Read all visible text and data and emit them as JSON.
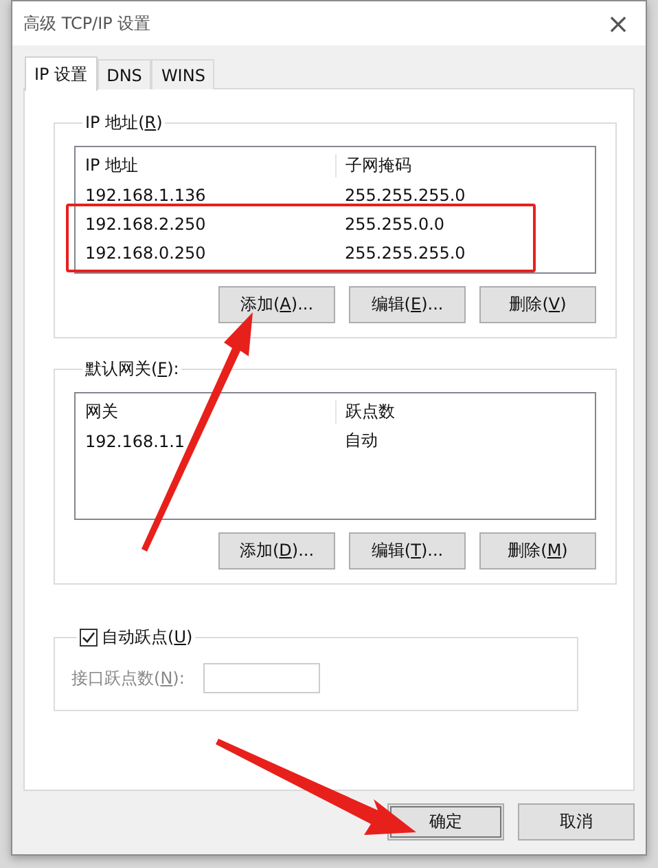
{
  "window": {
    "title": "高级 TCP/IP 设置",
    "close": "×"
  },
  "tabs": [
    {
      "label": "IP 设置",
      "selected": true
    },
    {
      "label": "DNS",
      "selected": false
    },
    {
      "label": "WINS",
      "selected": false
    }
  ],
  "ip_group": {
    "label": "IP 地址(R)",
    "columns": [
      "IP 地址",
      "子网掩码"
    ],
    "rows": [
      {
        "cells": [
          "192.168.1.136",
          "255.255.255.0"
        ],
        "highlighted": false
      },
      {
        "cells": [
          "192.168.2.250",
          "255.255.0.0"
        ],
        "highlighted": true
      },
      {
        "cells": [
          "192.168.0.250",
          "255.255.255.0"
        ],
        "highlighted": true
      }
    ],
    "buttons": [
      "添加(A)...",
      "编辑(E)...",
      "删除(V)"
    ]
  },
  "gateway_group": {
    "label": "默认网关(F):",
    "columns": [
      "网关",
      "跃点数"
    ],
    "rows": [
      {
        "cells": [
          "192.168.1.1",
          "自动"
        ]
      }
    ],
    "buttons": [
      "添加(D)...",
      "编辑(T)...",
      "删除(M)"
    ]
  },
  "metric": {
    "checkbox_label": "自动跃点(U)",
    "checked": true,
    "field_label": "接口跃点数(N):",
    "disabled": true
  },
  "footer_buttons": [
    {
      "label": "确定",
      "default": true
    },
    {
      "label": "取消",
      "default": false
    }
  ]
}
